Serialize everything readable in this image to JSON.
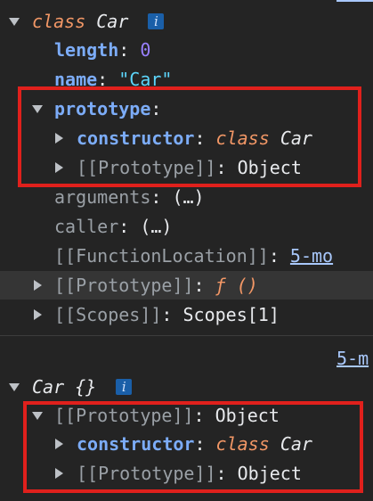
{
  "colors": {
    "background": "#242424",
    "highlight_box": "#e0201c",
    "keyword": "#f29766",
    "property_key": "#7cacf8",
    "number": "#9980ff",
    "string": "#5cd5fb",
    "link": "#a8c7fa"
  },
  "car_class": {
    "keyword": "class",
    "name": "Car",
    "info_icon": "i",
    "length": {
      "key": "length",
      "sep": ": ",
      "value": "0"
    },
    "name_prop": {
      "key": "name",
      "sep": ": ",
      "value": "\"Car\""
    },
    "prototype": {
      "key": "prototype",
      "sep": ":",
      "constructor": {
        "key": "constructor",
        "sep": ": ",
        "keyword": "class",
        "value": "Car"
      },
      "proto": {
        "key": "[[Prototype]]",
        "sep": ": ",
        "value": "Object"
      }
    },
    "arguments": {
      "key": "arguments",
      "sep": ": ",
      "value": "(…)"
    },
    "caller": {
      "key": "caller",
      "sep": ": ",
      "value": "(…)"
    },
    "function_location": {
      "key": "[[FunctionLocation]]",
      "sep": ": ",
      "value": "5-mo"
    },
    "proto": {
      "key": "[[Prototype]]",
      "sep": ": ",
      "value": "ƒ ()"
    },
    "scopes": {
      "key": "[[Scopes]]",
      "sep": ": ",
      "value": "Scopes[1]"
    }
  },
  "source_link": "5-m",
  "car_instance": {
    "name": "Car",
    "braces": "{}",
    "info_icon": "i",
    "proto": {
      "key": "[[Prototype]]",
      "sep": ": ",
      "value": "Object",
      "constructor": {
        "key": "constructor",
        "sep": ": ",
        "keyword": "class",
        "value": "Car"
      },
      "inner_proto": {
        "key": "[[Prototype]]",
        "sep": ": ",
        "value": "Object"
      }
    }
  }
}
